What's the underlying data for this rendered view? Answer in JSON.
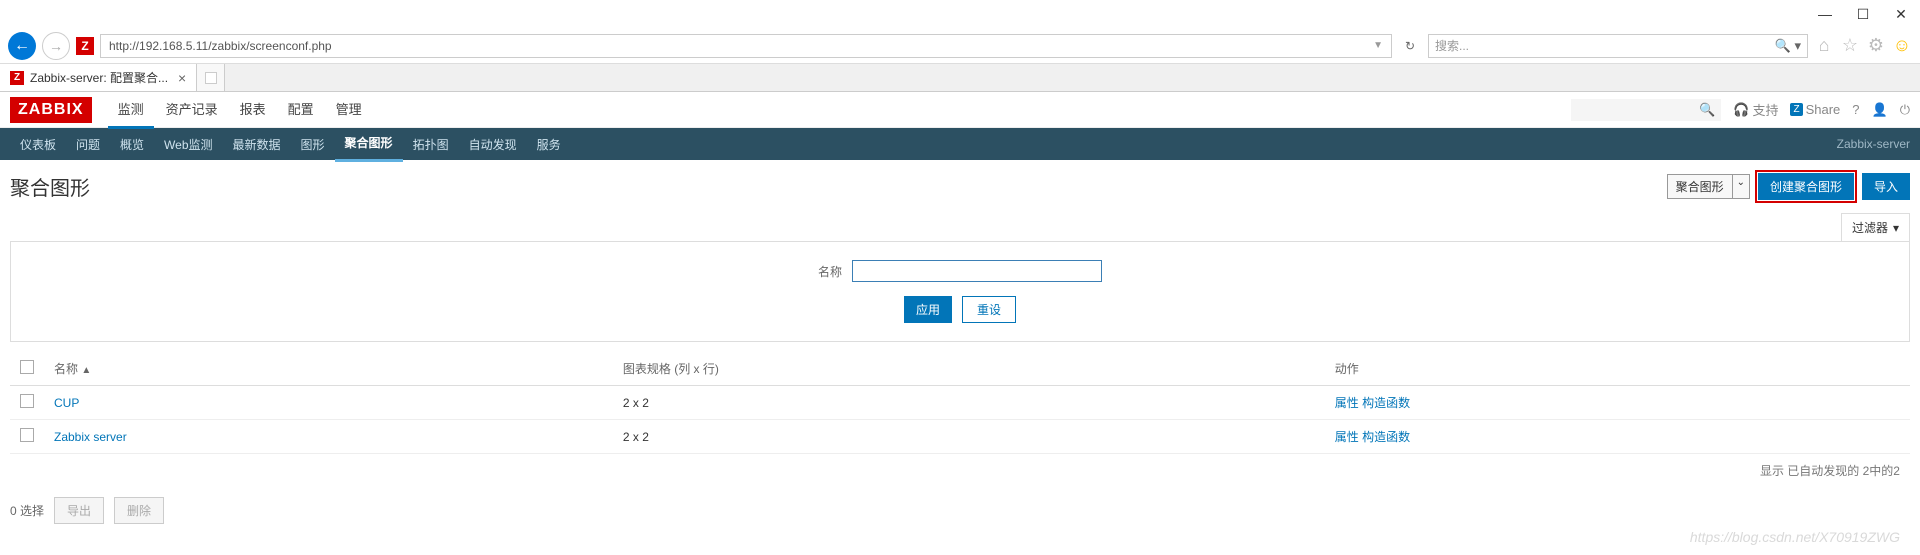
{
  "browser": {
    "url": "http://192.168.5.11/zabbix/screenconf.php",
    "search_placeholder": "搜索...",
    "tab_title": "Zabbix-server: 配置聚合...",
    "tab_close": "×"
  },
  "header": {
    "logo": "ZABBIX",
    "nav": [
      "监测",
      "资产记录",
      "报表",
      "配置",
      "管理"
    ],
    "active_nav_index": 0,
    "support": "支持",
    "share": "Share",
    "help": "?"
  },
  "subnav": {
    "items": [
      "仪表板",
      "问题",
      "概览",
      "Web监测",
      "最新数据",
      "图形",
      "聚合图形",
      "拓扑图",
      "自动发现",
      "服务"
    ],
    "active_index": 6,
    "host": "Zabbix-server"
  },
  "page": {
    "title": "聚合图形",
    "select_value": "聚合图形",
    "btn_create": "创建聚合图形",
    "btn_import": "导入"
  },
  "filter": {
    "tab_label": "过滤器",
    "name_label": "名称",
    "name_value": "",
    "btn_apply": "应用",
    "btn_reset": "重设"
  },
  "table": {
    "headers": {
      "name": "名称",
      "dimensions": "图表规格 (列 x 行)",
      "actions": "动作"
    },
    "rows": [
      {
        "name": "CUP",
        "dimensions": "2 x 2",
        "action_properties": "属性",
        "action_constructor": "构造函数"
      },
      {
        "name": "Zabbix server",
        "dimensions": "2 x 2",
        "action_properties": "属性",
        "action_constructor": "构造函数"
      }
    ],
    "footer": "显示 已自动发现的 2中的2"
  },
  "bottom": {
    "selected": "0 选择",
    "btn_export": "导出",
    "btn_delete": "删除"
  },
  "watermark": "https://blog.csdn.net/X70919ZWG"
}
